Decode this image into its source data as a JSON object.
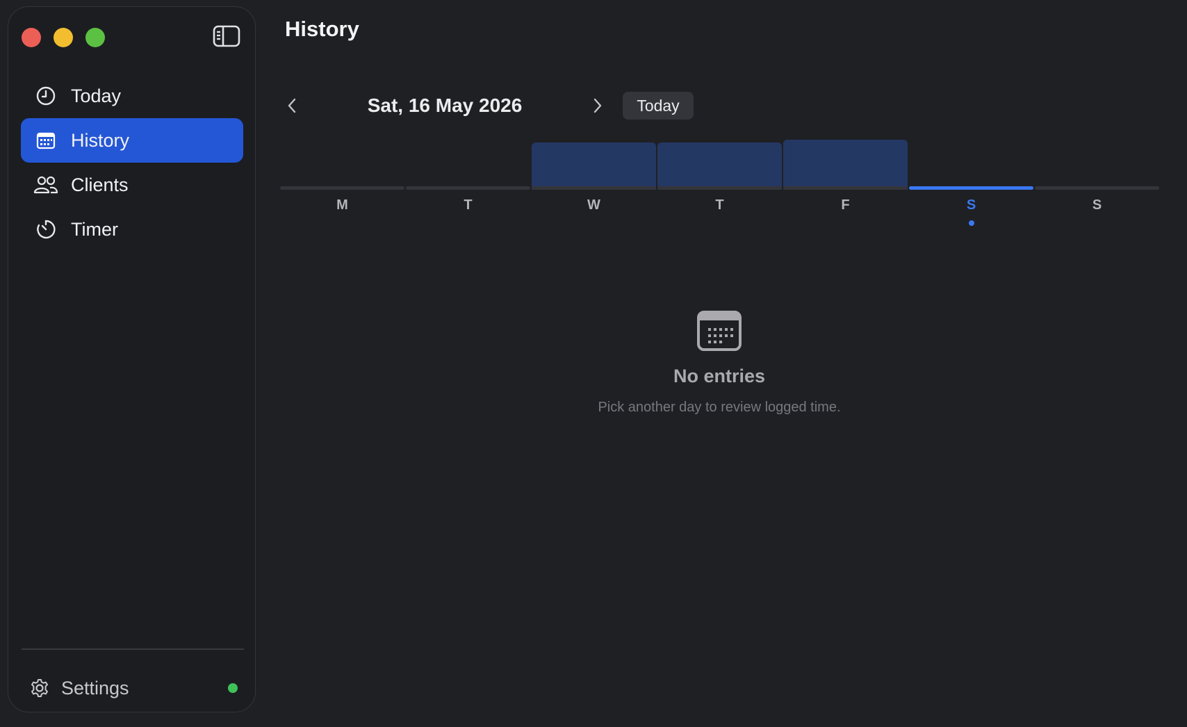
{
  "sidebar": {
    "items": [
      {
        "label": "Today",
        "icon": "clock-icon",
        "active": false
      },
      {
        "label": "History",
        "icon": "calendar-icon",
        "active": true
      },
      {
        "label": "Clients",
        "icon": "people-icon",
        "active": false
      },
      {
        "label": "Timer",
        "icon": "timer-icon",
        "active": false
      }
    ],
    "settings_label": "Settings",
    "status": "online"
  },
  "header": {
    "title": "History"
  },
  "date_nav": {
    "date_label": "Sat, 16 May 2026",
    "today_label": "Today"
  },
  "week": {
    "days": [
      {
        "letter": "M",
        "has_bar": false,
        "selected": false
      },
      {
        "letter": "T",
        "has_bar": false,
        "selected": false
      },
      {
        "letter": "W",
        "has_bar": true,
        "selected": false
      },
      {
        "letter": "T",
        "has_bar": true,
        "selected": false
      },
      {
        "letter": "F",
        "has_bar": true,
        "selected": false
      },
      {
        "letter": "S",
        "has_bar": false,
        "selected": true
      },
      {
        "letter": "S",
        "has_bar": false,
        "selected": false
      }
    ]
  },
  "empty_state": {
    "title": "No entries",
    "subtitle": "Pick another day to review logged time.",
    "icon": "calendar-icon"
  },
  "colors": {
    "accent": "#2457d6",
    "selected_day": "#3a78f2",
    "bar": "#243864",
    "status_dot": "#3fc15a"
  }
}
